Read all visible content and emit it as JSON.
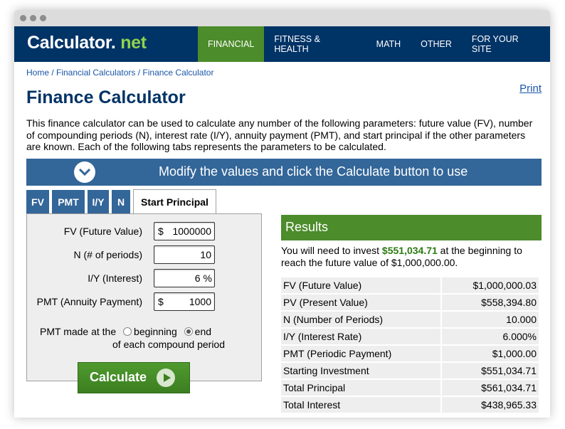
{
  "site": {
    "logo_main": "Calculator",
    "logo_dot": ".",
    "logo_suffix": "net",
    "nav": [
      "FINANCIAL",
      "FITNESS & HEALTH",
      "MATH",
      "OTHER",
      "FOR YOUR SITE"
    ],
    "active_nav": "FINANCIAL"
  },
  "breadcrumb": "Home / Financial Calculators / Finance Calculator",
  "print_label": "Print",
  "title": "Finance Calculator",
  "intro": "This finance calculator can be used to calculate any number of the following parameters: future value (FV), number of compounding periods (N), interest rate (I/Y), annuity payment (PMT), and start principal if the other parameters are known. Each of the following tabs represents the parameters to be calculated.",
  "banner_text": "Modify the values and click the Calculate button to use",
  "tabs": [
    {
      "label": "FV",
      "active": false
    },
    {
      "label": "PMT",
      "active": false
    },
    {
      "label": "I/Y",
      "active": false
    },
    {
      "label": "N",
      "active": false
    },
    {
      "label": "Start Principal",
      "active": true
    }
  ],
  "form": {
    "fv_label": "FV (Future Value)",
    "fv_prefix": "$",
    "fv_value": "1000000",
    "n_label": "N (# of periods)",
    "n_value": "10",
    "iy_label": "I/Y (Interest)",
    "iy_value": "6",
    "iy_suffix": "%",
    "pmt_label": "PMT (Annuity Payment)",
    "pmt_prefix": "$",
    "pmt_value": "1000",
    "pmt_timing_prefix": "PMT made at the",
    "option_beginning": "beginning",
    "option_end": "end",
    "pmt_timing_suffix": "of each compound period",
    "selected_option": "end",
    "calculate_label": "Calculate"
  },
  "results": {
    "heading": "Results",
    "text_before": "You will need to invest",
    "highlight": "$551,034.71",
    "text_after": "at the beginning to reach the future value of $1,000,000.00.",
    "rows": [
      {
        "label": "FV (Future Value)",
        "value": "$1,000,000.03"
      },
      {
        "label": "PV (Present Value)",
        "value": "$558,394.80"
      },
      {
        "label": "N (Number of Periods)",
        "value": "10.000"
      },
      {
        "label": "I/Y (Interest Rate)",
        "value": "6.000%"
      },
      {
        "label": "PMT (Periodic Payment)",
        "value": "$1,000.00"
      },
      {
        "label": "Starting Investment",
        "value": "$551,034.71"
      },
      {
        "label": "Total Principal",
        "value": "$561,034.71"
      },
      {
        "label": "Total Interest",
        "value": "$438,965.33"
      }
    ]
  },
  "colors": {
    "header_bg": "#003366",
    "accent_green": "#4c8c2b",
    "banner_blue": "#336699",
    "link_blue": "#1a56a8"
  }
}
